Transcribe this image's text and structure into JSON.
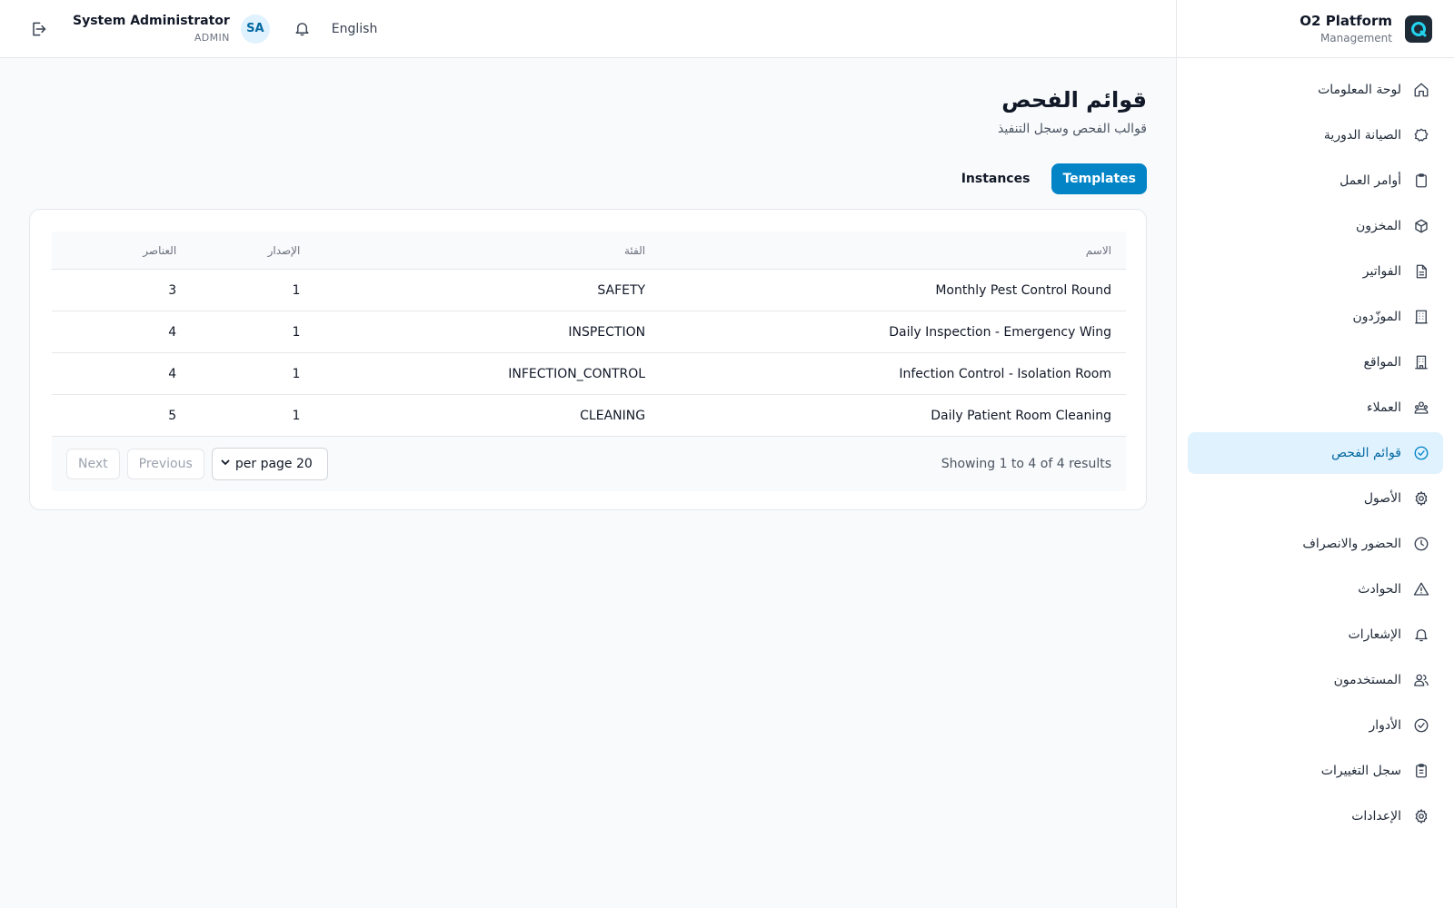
{
  "brand": {
    "title": "O2 Platform",
    "subtitle": "Management"
  },
  "header": {
    "user_name": "System Administrator",
    "user_role": "ADMIN",
    "avatar_initials": "SA",
    "language": "English"
  },
  "sidebar": {
    "items": [
      {
        "label": "لوحة المعلومات",
        "icon": "home-icon",
        "active": false
      },
      {
        "label": "الصيانة الدورية",
        "icon": "badge-icon",
        "active": false
      },
      {
        "label": "أوامر العمل",
        "icon": "clipboard-icon",
        "active": false
      },
      {
        "label": "المخزون",
        "icon": "box-icon",
        "active": false
      },
      {
        "label": "الفواتير",
        "icon": "file-icon",
        "active": false
      },
      {
        "label": "الموزّدون",
        "icon": "building-icon",
        "active": false
      },
      {
        "label": "المواقع",
        "icon": "office-icon",
        "active": false
      },
      {
        "label": "العملاء",
        "icon": "customers-icon",
        "active": false
      },
      {
        "label": "قوائم الفحص",
        "icon": "check-circle-icon",
        "active": true
      },
      {
        "label": "الأصول",
        "icon": "gear-icon",
        "active": false
      },
      {
        "label": "الحضور والانصراف",
        "icon": "clock-icon",
        "active": false
      },
      {
        "label": "الحوادث",
        "icon": "warning-icon",
        "active": false
      },
      {
        "label": "الإشعارات",
        "icon": "bell-icon",
        "active": false
      },
      {
        "label": "المستخدمون",
        "icon": "users-icon",
        "active": false
      },
      {
        "label": "الأدوار",
        "icon": "check-circle-icon",
        "active": false
      },
      {
        "label": "سجل التغييرات",
        "icon": "list-clipboard-icon",
        "active": false
      },
      {
        "label": "الإعدادات",
        "icon": "settings-icon",
        "active": false
      }
    ]
  },
  "page": {
    "title": "قوائم الفحص",
    "subtitle": "قوالب الفحص وسجل التنفيذ",
    "tabs": [
      {
        "label": "Templates",
        "active": true
      },
      {
        "label": "Instances",
        "active": false
      }
    ]
  },
  "table": {
    "headers": {
      "name": "الاسم",
      "category": "الفئة",
      "version": "الإصدار",
      "items": "العناصر"
    },
    "rows": [
      {
        "name": "Monthly Pest Control Round",
        "category": "SAFETY",
        "version": "1",
        "items": "3"
      },
      {
        "name": "Daily Inspection - Emergency Wing",
        "category": "INSPECTION",
        "version": "1",
        "items": "4"
      },
      {
        "name": "Infection Control - Isolation Room",
        "category": "INFECTION_CONTROL",
        "version": "1",
        "items": "4"
      },
      {
        "name": "Daily Patient Room Cleaning",
        "category": "CLEANING",
        "version": "1",
        "items": "5"
      }
    ]
  },
  "pagination": {
    "showing": "Showing 1 to 4 of 4 results",
    "per_page": "per page 20",
    "previous": "Previous",
    "next": "Next"
  },
  "colors": {
    "accent": "#0284c7",
    "active_bg": "#e0f2fe",
    "active_text": "#0369a1"
  }
}
